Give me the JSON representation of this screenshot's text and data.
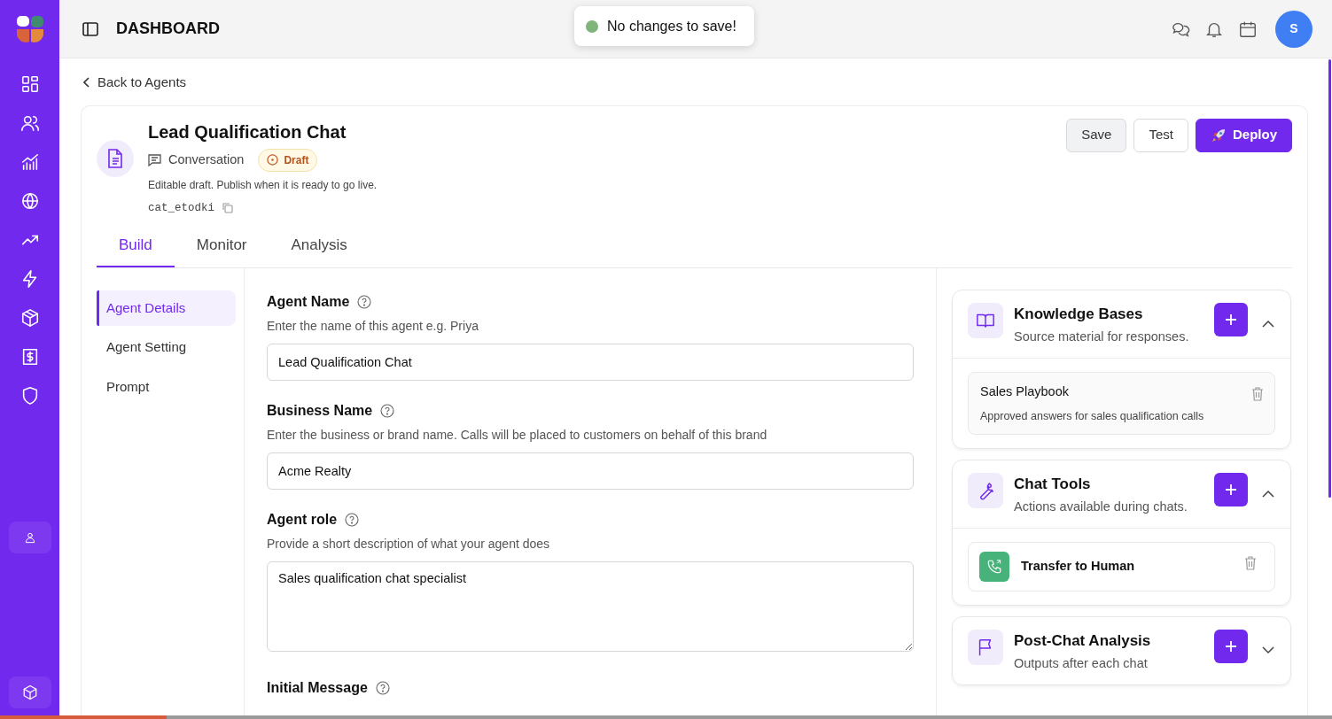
{
  "header": {
    "title": "DASHBOARD",
    "avatar": "S"
  },
  "toast": {
    "message": "No changes to save!"
  },
  "back_link": "Back to Agents",
  "agent": {
    "name": "Lead Qualification Chat",
    "type": "Conversation",
    "status": "Draft",
    "note": "Editable draft. Publish when it is ready to go live.",
    "id": "cat_etodki"
  },
  "actions": [
    {
      "label": "Save",
      "kind": "secondary"
    },
    {
      "label": "Test",
      "kind": "outline"
    },
    {
      "label": "Deploy",
      "kind": "primary"
    }
  ],
  "tabs": [
    {
      "label": "Build",
      "selected": true
    },
    {
      "label": "Monitor",
      "selected": false
    },
    {
      "label": "Analysis",
      "selected": false
    }
  ],
  "sections": [
    {
      "label": "Agent Details",
      "selected": true
    },
    {
      "label": "Agent Setting",
      "selected": false
    },
    {
      "label": "Prompt",
      "selected": false
    }
  ],
  "fields": [
    {
      "kind": "input",
      "label": "Agent Name",
      "hint": "Enter the name of this agent e.g. Priya",
      "value": "Lead Qualification Chat"
    },
    {
      "kind": "input",
      "label": "Business Name",
      "hint": "Enter the business or brand name. Calls will be placed to customers on behalf of this brand",
      "value": "Acme Realty"
    },
    {
      "kind": "textarea",
      "label": "Agent role",
      "hint": "Provide a short description of what your agent does",
      "value": "Sales qualification chat specialist"
    },
    {
      "kind": "heading",
      "label": "Initial Message"
    }
  ],
  "panels": [
    {
      "title": "Knowledge Bases",
      "subtitle": "Source material for responses.",
      "expanded": true,
      "items": [
        {
          "kind": "document",
          "title": "Sales Playbook",
          "description": "Approved answers for sales qualification calls"
        }
      ]
    },
    {
      "title": "Chat Tools",
      "subtitle": "Actions available during chats.",
      "expanded": true,
      "items": [
        {
          "kind": "tool",
          "title": "Transfer to Human"
        }
      ]
    },
    {
      "title": "Post-Chat Analysis",
      "subtitle": "Outputs after each chat",
      "expanded": false
    }
  ],
  "progress": {
    "level": 0.125
  }
}
